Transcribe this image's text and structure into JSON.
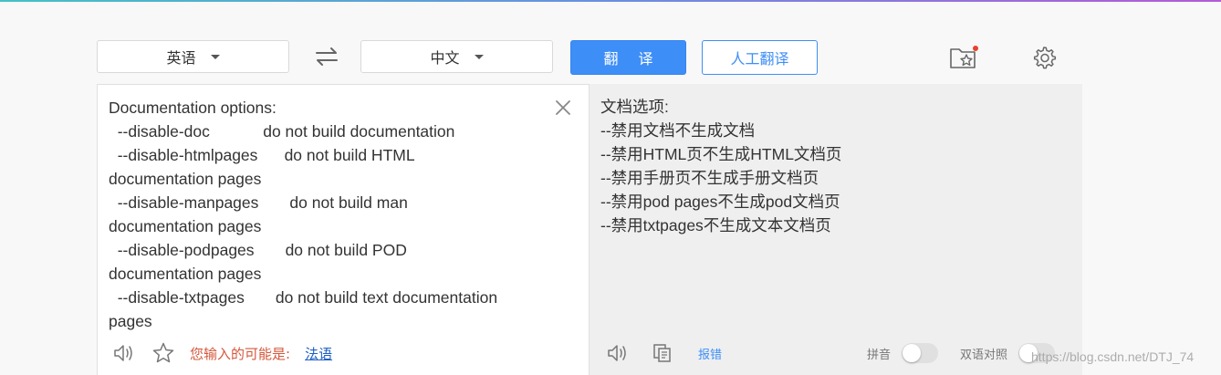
{
  "toolbar": {
    "source_language": "英语",
    "target_language": "中文",
    "translate_label": "翻译",
    "human_translate_label": "人工翻译"
  },
  "source": {
    "lines": [
      "Documentation options:",
      "  --disable-doc            do not build documentation",
      "  --disable-htmlpages      do not build HTML",
      "documentation pages",
      "  --disable-manpages       do not build man",
      "documentation pages",
      "  --disable-podpages       do not build POD",
      "documentation pages",
      "  --disable-txtpages       do not build text documentation",
      "pages"
    ],
    "hint_text": "您输入的可能是:",
    "hint_link": "法语"
  },
  "target": {
    "lines": [
      "文档选项:",
      "--禁用文档不生成文档",
      "--禁用HTML页不生成HTML文档页",
      "--禁用手册页不生成手册文档页",
      "--禁用pod pages不生成pod文档页",
      "--禁用txtpages不生成文本文档页"
    ],
    "report_label": "报错",
    "pinyin_label": "拼音",
    "bilingual_label": "双语对照",
    "pinyin_on": false,
    "bilingual_on": false
  },
  "watermark": "https://blog.csdn.net/DTJ_74",
  "colors": {
    "accent": "#3e8ef7",
    "hint": "#d4583b",
    "link": "#1d5fc4",
    "notification_dot": "#e8412c"
  }
}
